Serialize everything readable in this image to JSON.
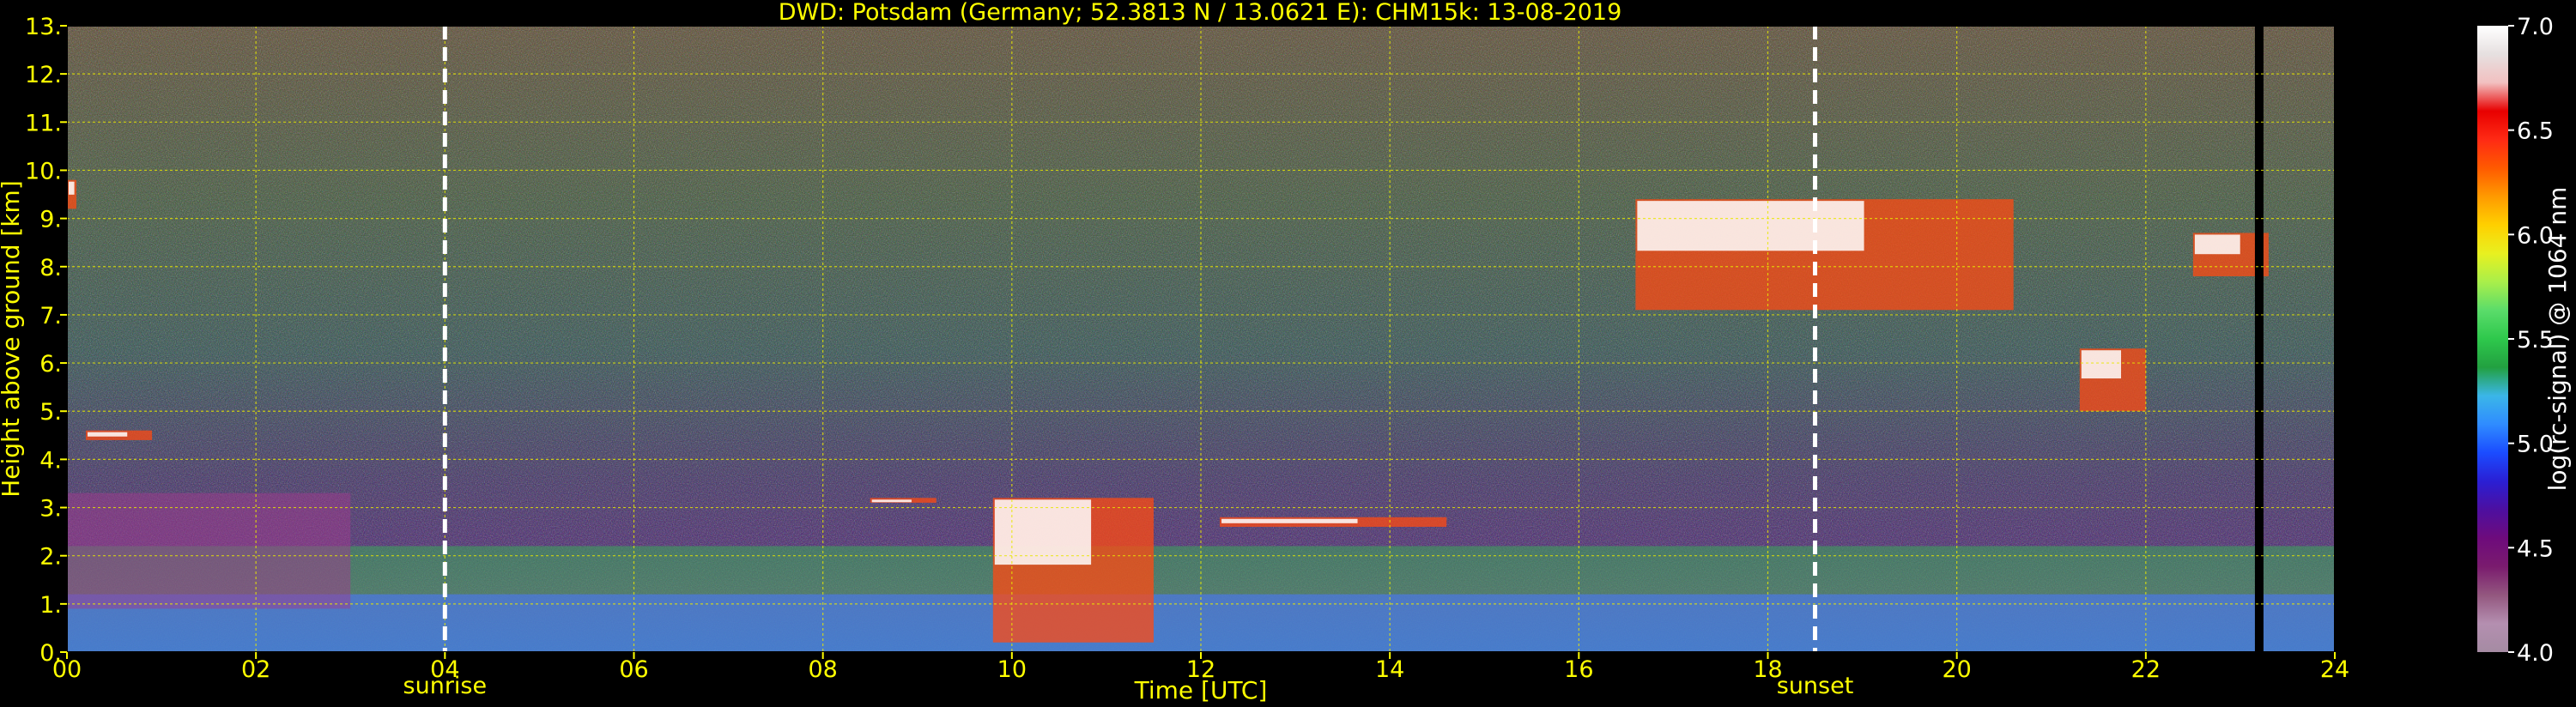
{
  "chart_data": {
    "type": "heatmap",
    "title": "DWD: Potsdam (Germany; 52.3813 N / 13.0621 E):    CHM15k: 13-08-2019",
    "xlabel": "Time [UTC]",
    "ylabel": "Height above ground [km]",
    "xlim": [
      0,
      24
    ],
    "ylim": [
      0,
      13
    ],
    "x_ticks": [
      "00",
      "02",
      "04",
      "06",
      "08",
      "10",
      "12",
      "14",
      "16",
      "18",
      "20",
      "22",
      "24"
    ],
    "y_ticks": [
      "0.",
      "1.",
      "2.",
      "3.",
      "4.",
      "5.",
      "6.",
      "7.",
      "8.",
      "9.",
      "10.",
      "11.",
      "12.",
      "13."
    ],
    "grid": true,
    "annotations": [
      {
        "label": "sunrise",
        "x": 4.0
      },
      {
        "label": "sunset",
        "x": 18.5
      }
    ],
    "data_gap_at_hour": 23.2,
    "colorbar": {
      "label": "log(rc-signal) @ 1064 nm",
      "range": [
        4.0,
        7.0
      ],
      "ticks": [
        "4.0",
        "4.5",
        "5.0",
        "5.5",
        "6.0",
        "6.5",
        "7.0"
      ],
      "colors": [
        "#a58ba3",
        "#b48fb0",
        "#93577f",
        "#7a1b6e",
        "#6e0b7c",
        "#4d0fa0",
        "#2a1fd4",
        "#1b4cff",
        "#2f8cff",
        "#3bb6e8",
        "#22a040",
        "#2ec84c",
        "#5adc6a",
        "#a9ef4a",
        "#e8f020",
        "#ffd000",
        "#ff9a00",
        "#ff5a00",
        "#ff2a14",
        "#e80000",
        "#f2c0c0",
        "#e6e0e0",
        "#ffffff"
      ]
    },
    "layers": [
      {
        "name": "boundary layer (aerosol)",
        "t_start": 0.0,
        "t_end": 24.0,
        "top_km": 2.2
      },
      {
        "name": "residual layer",
        "t_start": 0.0,
        "t_end": 3.0,
        "top_km": 3.3
      },
      {
        "name": "cloud",
        "t_start": 0.0,
        "t_end": 0.1,
        "base_km": 9.2,
        "top_km": 9.8
      },
      {
        "name": "cloud",
        "t_start": 0.2,
        "t_end": 0.9,
        "base_km": 4.4,
        "top_km": 4.6
      },
      {
        "name": "cloud",
        "t_start": 8.5,
        "t_end": 9.2,
        "base_km": 3.1,
        "top_km": 3.2
      },
      {
        "name": "cloud",
        "t_start": 9.8,
        "t_end": 11.5,
        "base_km": 0.2,
        "top_km": 3.2
      },
      {
        "name": "cloud",
        "t_start": 12.2,
        "t_end": 14.6,
        "base_km": 2.6,
        "top_km": 2.8
      },
      {
        "name": "cloud",
        "t_start": 16.6,
        "t_end": 20.6,
        "base_km": 7.1,
        "top_km": 9.4
      },
      {
        "name": "cloud",
        "t_start": 21.3,
        "t_end": 22.0,
        "base_km": 5.0,
        "top_km": 6.3
      },
      {
        "name": "cloud",
        "t_start": 22.5,
        "t_end": 23.3,
        "base_km": 7.8,
        "top_km": 8.7
      }
    ]
  }
}
